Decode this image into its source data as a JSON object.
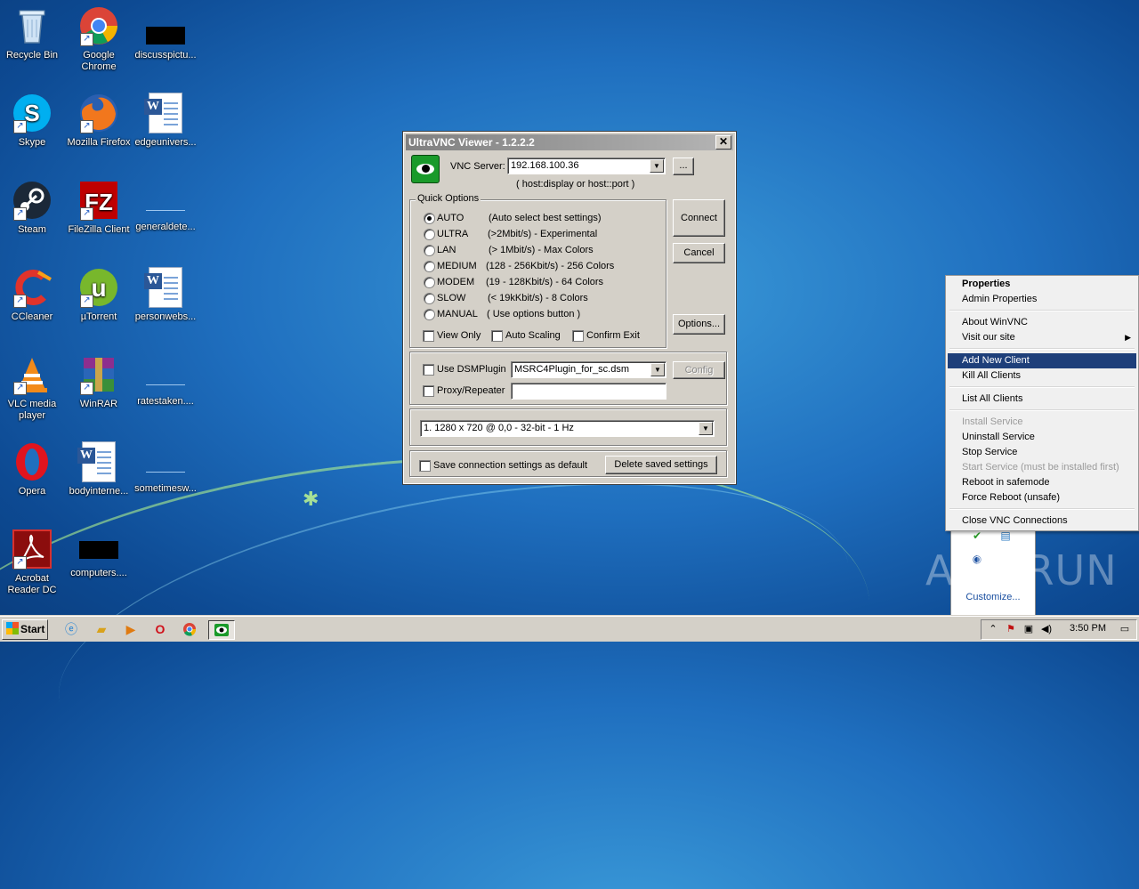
{
  "desktop": {
    "icons": [
      {
        "label": "Recycle Bin",
        "icon": "recycle-bin-icon"
      },
      {
        "label": "Google Chrome",
        "icon": "chrome-icon"
      },
      {
        "label": "discusspictu...",
        "icon": "file-icon"
      },
      {
        "label": "Skype",
        "icon": "skype-icon"
      },
      {
        "label": "Mozilla Firefox",
        "icon": "firefox-icon"
      },
      {
        "label": "edgeunivers...",
        "icon": "word-doc-icon"
      },
      {
        "label": "Steam",
        "icon": "steam-icon"
      },
      {
        "label": "FileZilla Client",
        "icon": "filezilla-icon"
      },
      {
        "label": "generaldete...",
        "icon": "file-icon"
      },
      {
        "label": "CCleaner",
        "icon": "ccleaner-icon"
      },
      {
        "label": "µTorrent",
        "icon": "utorrent-icon"
      },
      {
        "label": "personwebs...",
        "icon": "word-doc-icon"
      },
      {
        "label": "VLC media player",
        "icon": "vlc-icon"
      },
      {
        "label": "WinRAR",
        "icon": "winrar-icon"
      },
      {
        "label": "ratestaken....",
        "icon": "file-icon"
      },
      {
        "label": "Opera",
        "icon": "opera-icon"
      },
      {
        "label": "bodyinterne...",
        "icon": "word-doc-icon"
      },
      {
        "label": "sometimesw...",
        "icon": "file-icon"
      },
      {
        "label": "Acrobat Reader DC",
        "icon": "acrobat-icon"
      },
      {
        "label": "computers....",
        "icon": "file-icon"
      }
    ]
  },
  "vnc_dialog": {
    "title": "UltraVNC Viewer - 1.2.2.2",
    "close_label": "✕",
    "server_label": "VNC Server:",
    "server_value": "192.168.100.36",
    "browse_label": "...",
    "hint": "( host:display or host::port )",
    "quick_options_label": "Quick Options",
    "options": [
      {
        "name": "AUTO",
        "desc": "(Auto select best settings)",
        "selected": true
      },
      {
        "name": "ULTRA",
        "desc": "(>2Mbit/s) - Experimental",
        "selected": false
      },
      {
        "name": "LAN",
        "desc": "(> 1Mbit/s) - Max Colors",
        "selected": false
      },
      {
        "name": "MEDIUM",
        "desc": "(128 - 256Kbit/s) - 256 Colors",
        "selected": false
      },
      {
        "name": "MODEM",
        "desc": "(19 - 128Kbit/s) - 64 Colors",
        "selected": false
      },
      {
        "name": "SLOW",
        "desc": "(< 19kKbit/s) - 8 Colors",
        "selected": false
      },
      {
        "name": "MANUAL",
        "desc": "( Use options button )",
        "selected": false
      }
    ],
    "view_only": "View Only",
    "auto_scaling": "Auto Scaling",
    "confirm_exit": "Confirm Exit",
    "connect": "Connect",
    "cancel": "Cancel",
    "options_button": "Options...",
    "use_dsm": "Use DSMPlugin",
    "dsm_value": "MSRC4Plugin_for_sc.dsm",
    "config": "Config",
    "proxy": "Proxy/Repeater",
    "proxy_value": "",
    "display_value": "1. 1280 x 720 @ 0,0 - 32-bit - 1 Hz",
    "save_settings": "Save connection settings as default",
    "delete_settings": "Delete saved settings"
  },
  "context_menu": {
    "items": [
      {
        "label": "Properties",
        "bold": true
      },
      {
        "label": "Admin Properties"
      },
      {
        "label": "About WinVNC"
      },
      {
        "label": "Visit our site",
        "submenu": true
      },
      {
        "label": "Add New Client",
        "selected": true
      },
      {
        "label": "Kill All Clients"
      },
      {
        "label": "List All Clients"
      },
      {
        "label": "Install Service",
        "disabled": true
      },
      {
        "label": "Uninstall Service"
      },
      {
        "label": "Stop Service"
      },
      {
        "label": "Start Service (must be installed first)",
        "disabled": true
      },
      {
        "label": "Reboot in safemode"
      },
      {
        "label": "Force Reboot (unsafe)"
      },
      {
        "label": "Close VNC Connections"
      }
    ],
    "submenu_arrow": "▶"
  },
  "tray_popup": {
    "customize": "Customize..."
  },
  "watermark": "ANY RUN",
  "taskbar": {
    "start": "Start",
    "clock": "3:50 PM",
    "pinned": [
      "ie-icon",
      "explorer-icon",
      "media-player-icon",
      "opera-icon",
      "chrome-icon",
      "ultravnc-icon"
    ]
  }
}
